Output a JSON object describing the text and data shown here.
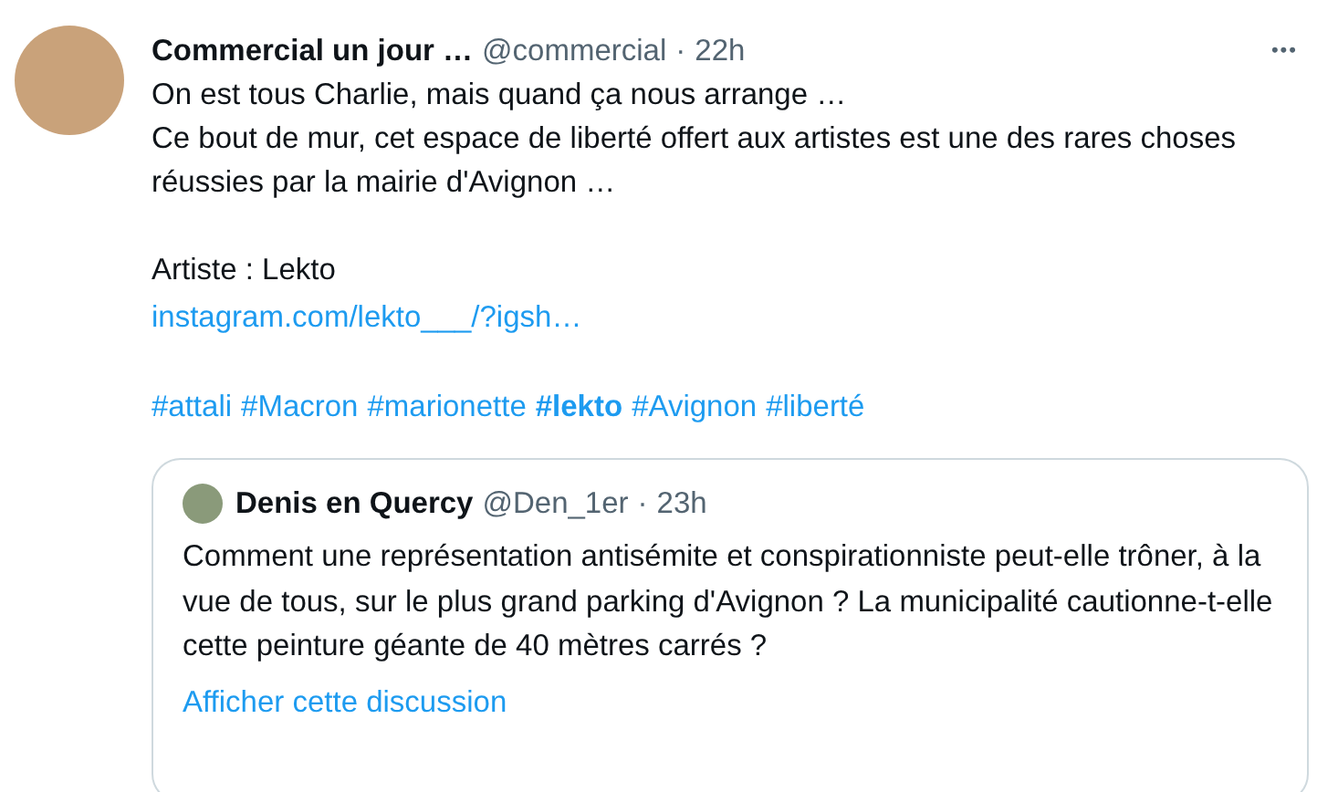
{
  "tweet": {
    "author": "Commercial un jour …",
    "handle": "@commercial",
    "separator": "·",
    "time": "22h",
    "more": "•••",
    "paragraphs": [
      "On est tous Charlie, mais quand ça nous arrange …",
      "Ce bout de mur, cet espace de liberté offert aux artistes est une des rares choses réussies par la mairie d'Avignon …"
    ],
    "artist_line": "Artiste : Lekto",
    "link": "instagram.com/lekto___/?igsh…",
    "hashtags": [
      {
        "text": "#attali",
        "bold": false
      },
      {
        "text": "#Macron",
        "bold": false
      },
      {
        "text": "#marionette",
        "bold": false
      },
      {
        "text": "#lekto",
        "bold": true
      },
      {
        "text": "#Avignon",
        "bold": false
      },
      {
        "text": "#liberté",
        "bold": false
      }
    ],
    "quote": {
      "author": "Denis en Quercy",
      "handle": "@Den_1er",
      "separator": "·",
      "time": "23h",
      "text": "Comment une représentation antisémite et conspirationniste peut-elle trôner, à la vue de tous, sur le plus grand parking d'Avignon ? La municipalité cautionne-t-elle cette peinture géante de 40 mètres carrés ?",
      "show_thread": "Afficher cette discussion"
    }
  }
}
